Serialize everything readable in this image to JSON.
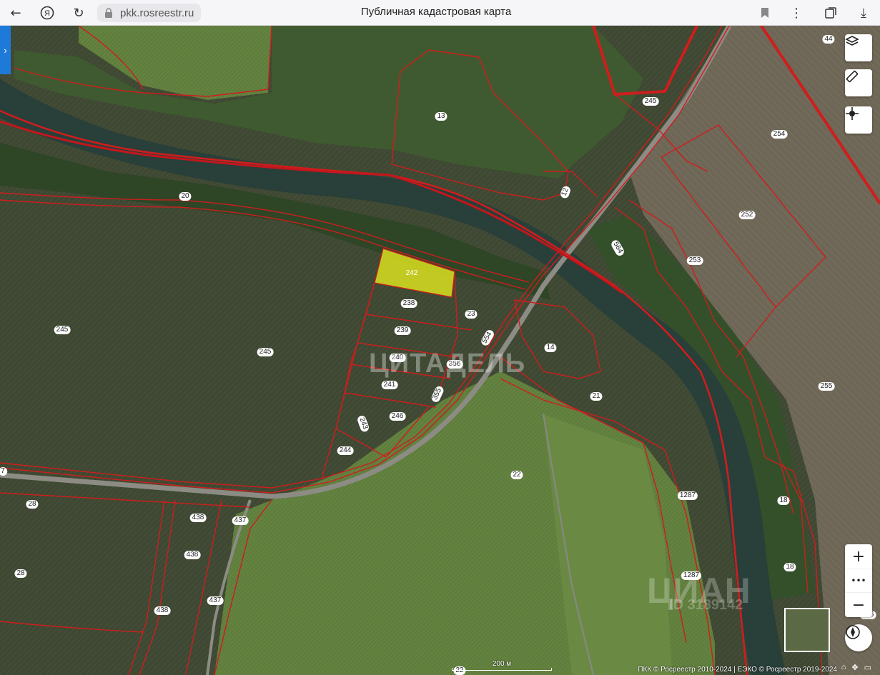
{
  "browser": {
    "url": "pkk.rosreestr.ru",
    "title": "Публичная кадастровая карта"
  },
  "map": {
    "selected_parcel": "242",
    "parcel_labels": [
      "44",
      "245",
      "13",
      "254",
      "12",
      "252",
      "20",
      "564",
      "253",
      "242",
      "238",
      "23",
      "239",
      "554",
      "14",
      "245",
      "240",
      "356",
      "241",
      "21",
      "355",
      "246",
      "243",
      "255",
      "244",
      "22",
      "7",
      "1287",
      "18",
      "28",
      "438",
      "437",
      "438",
      "28",
      "438",
      "437",
      "1287",
      "18",
      "256",
      "22",
      "245"
    ],
    "watermark_text": "ЦИТАДЕЛЬ",
    "watermark2_text": "ЦИАН",
    "watermark3_text": "ID 3189142",
    "scale_label": "200 м",
    "attribution": "ПКК © Росреестр 2010-2024 | ЕЭКО © Росреестр 2019-2024",
    "colors": {
      "boundary": "#d01d1d",
      "selected_fill": "#d9e020",
      "accent": "#1e7ad8"
    }
  },
  "controls": {
    "layers_icon": "layers-icon",
    "ruler_icon": "ruler-icon",
    "locate_icon": "crosshair-icon",
    "zoom_in": "+",
    "zoom_more": "•••",
    "zoom_out": "−",
    "compass_icon": "compass-icon"
  }
}
